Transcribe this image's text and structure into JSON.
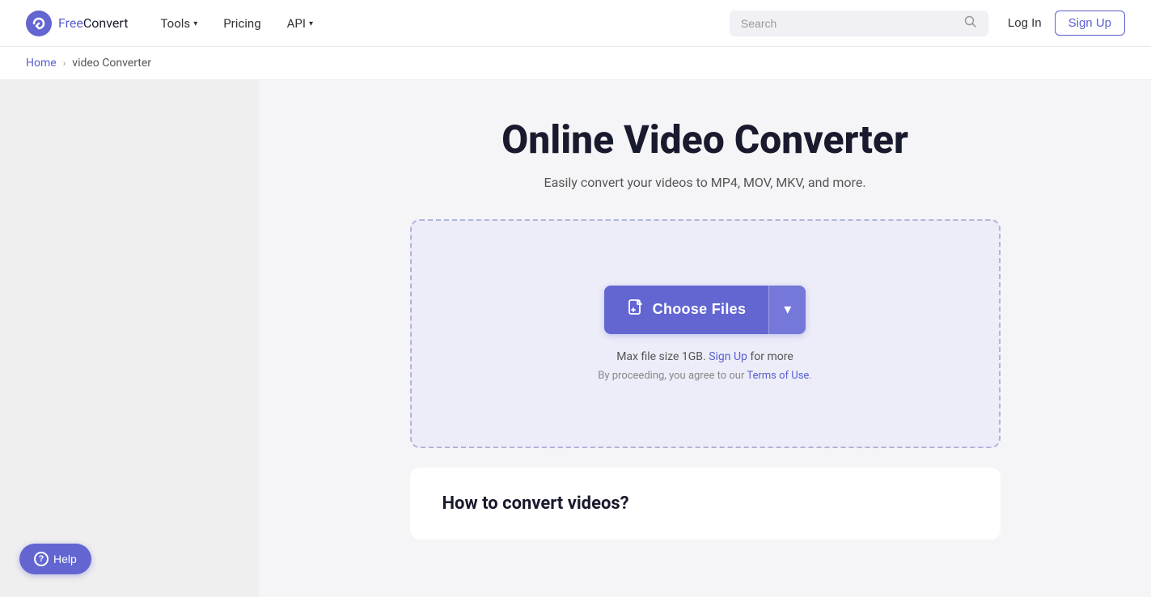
{
  "brand": {
    "name_free": "Free",
    "name_convert": "Convert",
    "logo_alt": "FreeConvert logo"
  },
  "navbar": {
    "tools_label": "Tools",
    "pricing_label": "Pricing",
    "api_label": "API",
    "search_placeholder": "Search",
    "login_label": "Log In",
    "signup_label": "Sign Up"
  },
  "breadcrumb": {
    "home_label": "Home",
    "separator": "›",
    "current_label": "video Converter"
  },
  "main": {
    "title": "Online Video Converter",
    "subtitle": "Easily convert your videos to MP4, MOV, MKV, and more.",
    "choose_files_label": "Choose Files",
    "file_size_text": "Max file size 1GB.",
    "signup_link_label": "Sign Up",
    "file_size_suffix": " for more",
    "terms_prefix": "By proceeding, you agree to our ",
    "terms_link_label": "Terms of Use",
    "terms_suffix": ".",
    "how_to_title": "How to convert videos?"
  },
  "help": {
    "label": "Help",
    "icon": "?"
  }
}
